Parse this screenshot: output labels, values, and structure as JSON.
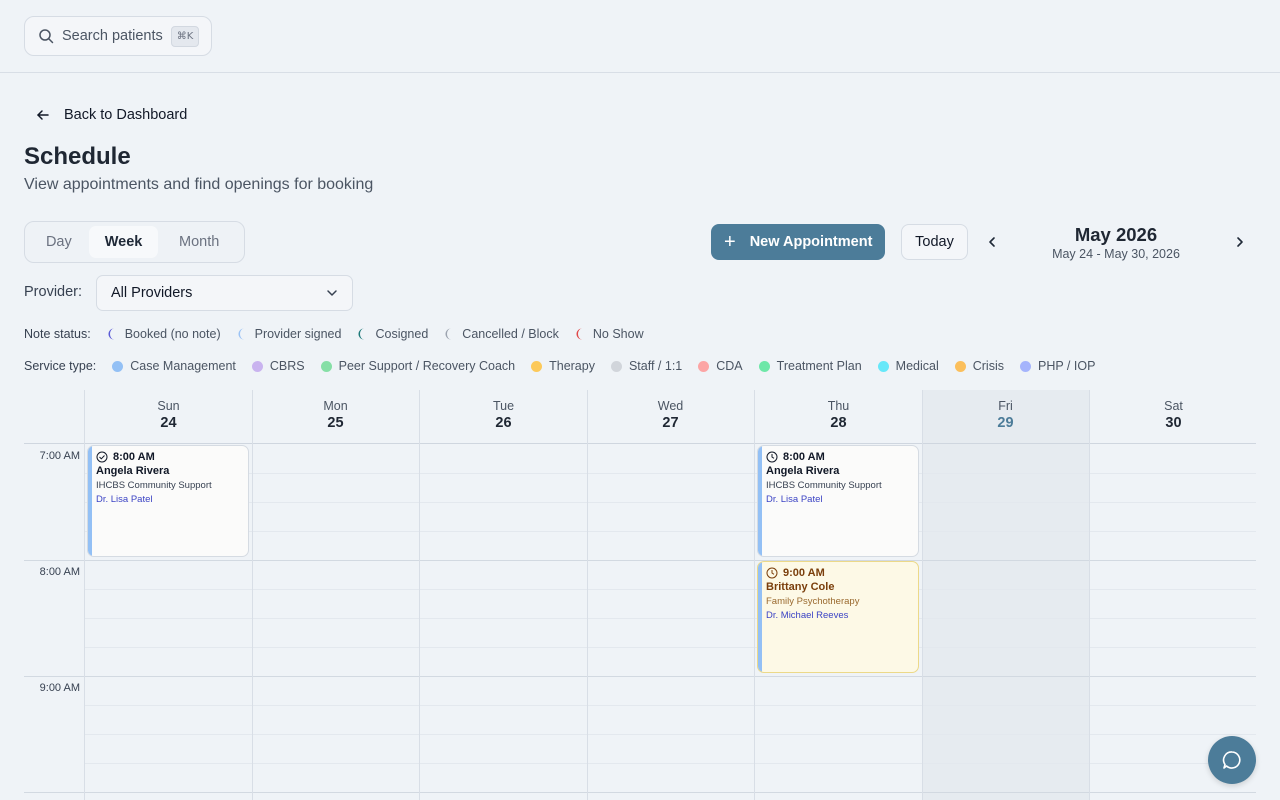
{
  "search": {
    "placeholder": "Search patients",
    "shortcut": "⌘K"
  },
  "nav": {
    "back_label": "Back to Dashboard"
  },
  "header": {
    "title": "Schedule",
    "subtitle": "View appointments and find openings for booking"
  },
  "views": {
    "day": "Day",
    "week": "Week",
    "month": "Month",
    "active": "Week"
  },
  "toolbar": {
    "new_appointment": "New Appointment",
    "today": "Today",
    "month_title": "May 2026",
    "range": "May 24 - May 30, 2026"
  },
  "provider": {
    "label": "Provider:",
    "selected": "All Providers"
  },
  "note_status": {
    "label": "Note status:",
    "items": [
      {
        "label": "Booked (no note)",
        "color": "#5b5bd6"
      },
      {
        "label": "Provider signed",
        "color": "#9cc3f5"
      },
      {
        "label": "Cosigned",
        "color": "#1f7a7a"
      },
      {
        "label": "Cancelled / Block",
        "color": "#9ca3af"
      },
      {
        "label": "No Show",
        "color": "#e04848"
      }
    ]
  },
  "service_type": {
    "label": "Service type:",
    "items": [
      {
        "label": "Case Management",
        "color": "#93c0f5"
      },
      {
        "label": "CBRS",
        "color": "#c9b3ef"
      },
      {
        "label": "Peer Support / Recovery Coach",
        "color": "#86dfa6"
      },
      {
        "label": "Therapy",
        "color": "#fcc95a"
      },
      {
        "label": "Staff / 1:1",
        "color": "#d1d5db"
      },
      {
        "label": "CDA",
        "color": "#fca5a5"
      },
      {
        "label": "Treatment Plan",
        "color": "#6ee7a8"
      },
      {
        "label": "Medical",
        "color": "#67e8f9"
      },
      {
        "label": "Crisis",
        "color": "#fbbf5c"
      },
      {
        "label": "PHP / IOP",
        "color": "#a5b4fc"
      }
    ]
  },
  "calendar": {
    "days": [
      {
        "name": "Sun",
        "num": "24"
      },
      {
        "name": "Mon",
        "num": "25"
      },
      {
        "name": "Tue",
        "num": "26"
      },
      {
        "name": "Wed",
        "num": "27"
      },
      {
        "name": "Thu",
        "num": "28"
      },
      {
        "name": "Fri",
        "num": "29",
        "today": true
      },
      {
        "name": "Sat",
        "num": "30"
      }
    ],
    "hours": [
      "7:00 AM",
      "8:00 AM",
      "9:00 AM"
    ],
    "events": [
      {
        "time": "8:00 AM",
        "patient": "Angela Rivera",
        "service": "IHCBS Community Support",
        "provider": "Dr. Lisa Patel",
        "status_icon": "check-circle-icon"
      },
      {
        "time": "8:00 AM",
        "patient": "Angela Rivera",
        "service": "IHCBS Community Support",
        "provider": "Dr. Lisa Patel",
        "status_icon": "clock-icon"
      },
      {
        "time": "9:00 AM",
        "patient": "Brittany Cole",
        "service": "Family Psychotherapy",
        "provider": "Dr. Michael Reeves",
        "status_icon": "clock-icon"
      }
    ]
  },
  "colors": {
    "accent": "#4c7c99",
    "background": "#eff3f7"
  }
}
